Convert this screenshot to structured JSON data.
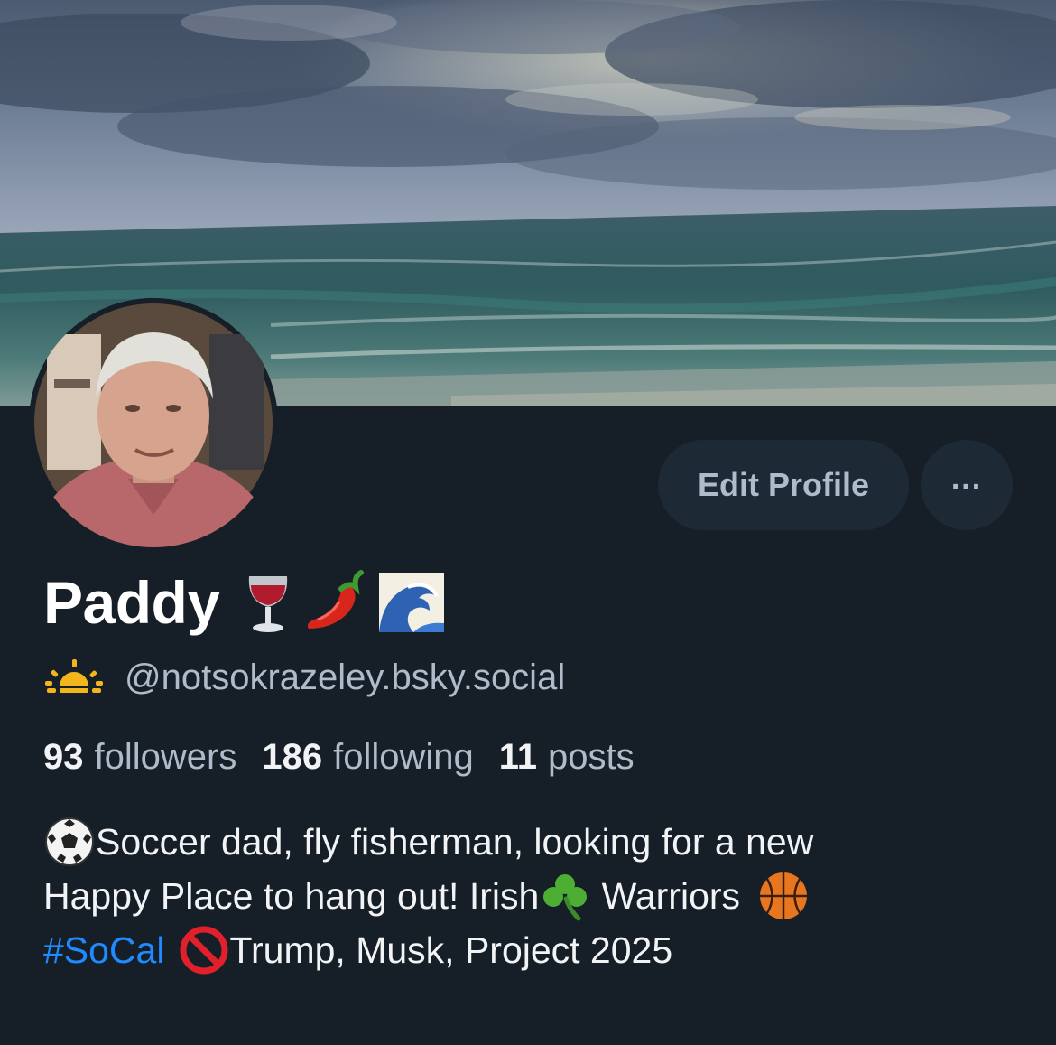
{
  "profile": {
    "display_name": "Paddy",
    "name_emojis": [
      "wine-glass-emoji",
      "hot-pepper-emoji",
      "wave-emoji"
    ],
    "handle_emoji": "sunrise-icon",
    "handle": "@notsokrazeley.bsky.social",
    "stats": {
      "followers_count": "93",
      "followers_label": "followers",
      "following_count": "186",
      "following_label": "following",
      "posts_count": "11",
      "posts_label": "posts"
    },
    "bio": {
      "line1_text": "Soccer dad, fly fisherman, looking for a new",
      "line2_text_a": "Happy Place to hang out! Irish",
      "line2_text_b": " Warriors ",
      "hashtag": "#SoCal",
      "line3_text": "Trump, Musk, Project 2025"
    }
  },
  "actions": {
    "edit_profile_label": "Edit Profile",
    "more_label": "..."
  },
  "colors": {
    "background": "#161e27",
    "button_bg": "#1e2936",
    "button_text": "#aebbc9",
    "link": "#208bfe",
    "secondary_text": "#aebbc9"
  }
}
